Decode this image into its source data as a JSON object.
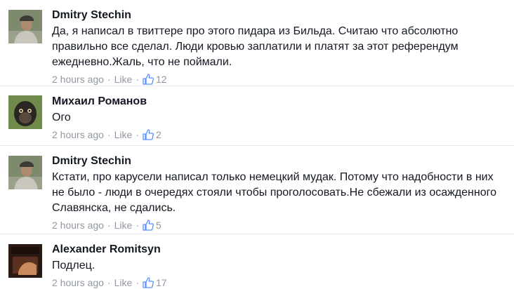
{
  "comments": [
    {
      "author": "Dmitry  Stechin",
      "text": "Да, я написал в твиттере про этого пидара из Бильда. Считаю что абсолютно правильно все сделал. Люди кровью заплатили и платят за этот референдум ежедневно.Жаль, что не поймали.",
      "time": "2 hours ago",
      "like_label": "Like",
      "separator": "·",
      "likes": "12",
      "avatar_icon": "person-photo-icon"
    },
    {
      "author": "Михаил Романов",
      "text": "Ого",
      "time": "2 hours ago",
      "like_label": "Like",
      "separator": "·",
      "likes": "2",
      "avatar_icon": "monkey-photo-icon"
    },
    {
      "author": "Dmitry  Stechin",
      "text": "Кстати, про карусели написал только немецкий мудак. Потому что надобности в них не было - люди в очередях стояли чтобы проголосовать.Не сбежали из осажденного Славянска, не сдались.",
      "time": "2 hours ago",
      "like_label": "Like",
      "separator": "·",
      "likes": "5",
      "avatar_icon": "person-photo-icon"
    },
    {
      "author": "Alexander Romitsyn",
      "text": "Подлец.",
      "time": "2 hours ago",
      "like_label": "Like",
      "separator": "·",
      "likes": "17",
      "avatar_icon": "dark-photo-icon"
    }
  ],
  "colors": {
    "text": "#141823",
    "meta": "#9197a3",
    "like_icon": "#5890ff",
    "divider": "#e9eaed"
  }
}
